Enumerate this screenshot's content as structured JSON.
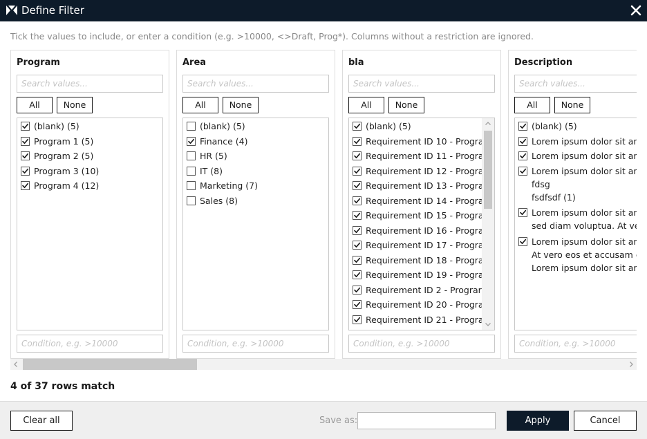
{
  "window": {
    "title": "Define Filter",
    "logo_icon": "app-logo-icon",
    "close_icon": "close-icon"
  },
  "hint": "Tick the values to include, or enter a condition (e.g. >10000, <>Draft, Prog*). Columns without a restriction are ignored.",
  "columns": [
    {
      "title": "Program",
      "search_placeholder": "Search values...",
      "all_label": "All",
      "none_label": "None",
      "condition_placeholder": "Condition, e.g. >10000",
      "items": [
        {
          "lines": [
            "(blank)  (5)"
          ],
          "checked": true
        },
        {
          "lines": [
            "Program 1  (5)"
          ],
          "checked": true
        },
        {
          "lines": [
            "Program 2  (5)"
          ],
          "checked": true
        },
        {
          "lines": [
            "Program 3  (10)"
          ],
          "checked": true
        },
        {
          "lines": [
            "Program 4  (12)"
          ],
          "checked": true
        }
      ]
    },
    {
      "title": "Area",
      "search_placeholder": "Search values...",
      "all_label": "All",
      "none_label": "None",
      "condition_placeholder": "Condition, e.g. >10000",
      "items": [
        {
          "lines": [
            "(blank)  (5)"
          ],
          "checked": false
        },
        {
          "lines": [
            "Finance  (4)"
          ],
          "checked": true
        },
        {
          "lines": [
            "HR  (5)"
          ],
          "checked": false
        },
        {
          "lines": [
            "IT  (8)"
          ],
          "checked": false
        },
        {
          "lines": [
            "Marketing  (7)"
          ],
          "checked": false
        },
        {
          "lines": [
            "Sales  (8)"
          ],
          "checked": false
        }
      ]
    },
    {
      "title": "bla",
      "search_placeholder": "Search values...",
      "all_label": "All",
      "none_label": "None",
      "condition_placeholder": "Condition, e.g. >10000",
      "has_scrollbar": true,
      "items": [
        {
          "lines": [
            "(blank)  (5)"
          ],
          "checked": true
        },
        {
          "lines": [
            "Requirement ID 10 - Progra"
          ],
          "checked": true
        },
        {
          "lines": [
            "Requirement ID 11 - Progra"
          ],
          "checked": true
        },
        {
          "lines": [
            "Requirement ID 12 - Progra"
          ],
          "checked": true
        },
        {
          "lines": [
            "Requirement ID 13 - Progra"
          ],
          "checked": true
        },
        {
          "lines": [
            "Requirement ID 14 - Progra"
          ],
          "checked": true
        },
        {
          "lines": [
            "Requirement ID 15 - Progra"
          ],
          "checked": true
        },
        {
          "lines": [
            "Requirement ID 16 - Progra"
          ],
          "checked": true
        },
        {
          "lines": [
            "Requirement ID 17 - Progra"
          ],
          "checked": true
        },
        {
          "lines": [
            "Requirement ID 18 - Progra"
          ],
          "checked": true
        },
        {
          "lines": [
            "Requirement ID 19 - Progra"
          ],
          "checked": true
        },
        {
          "lines": [
            "Requirement ID 2 - Prograr"
          ],
          "checked": true
        },
        {
          "lines": [
            "Requirement ID 20 - Progra"
          ],
          "checked": true
        },
        {
          "lines": [
            "Requirement ID 21 - Progra"
          ],
          "checked": true
        }
      ]
    },
    {
      "title": "Description",
      "search_placeholder": "Search values...",
      "all_label": "All",
      "none_label": "None",
      "condition_placeholder": "Condition, e.g. >10000",
      "items": [
        {
          "lines": [
            "(blank)  (5)"
          ],
          "checked": true
        },
        {
          "lines": [
            "Lorem ipsum dolor sit an"
          ],
          "checked": true
        },
        {
          "lines": [
            "Lorem ipsum dolor sit an"
          ],
          "checked": true
        },
        {
          "lines": [
            "Lorem ipsum dolor sit an",
            "fdsg",
            "fsdfsdf  (1)"
          ],
          "checked": true
        },
        {
          "lines": [
            "Lorem ipsum dolor sit an",
            "sed diam voluptua. At ve"
          ],
          "checked": true
        },
        {
          "lines": [
            "Lorem ipsum dolor sit an",
            "At vero eos et accusam e",
            "Lorem ipsum dolor sit an"
          ],
          "checked": true
        }
      ]
    }
  ],
  "match_text": "4 of 37 rows match",
  "footer": {
    "clear_label": "Clear all",
    "save_as_label": "Save as:",
    "save_as_value": "",
    "apply_label": "Apply",
    "cancel_label": "Cancel"
  },
  "colors": {
    "titlebar": "#0d1b2a",
    "apply_button": "#0d1b2a",
    "footer_bg": "#efefef"
  }
}
